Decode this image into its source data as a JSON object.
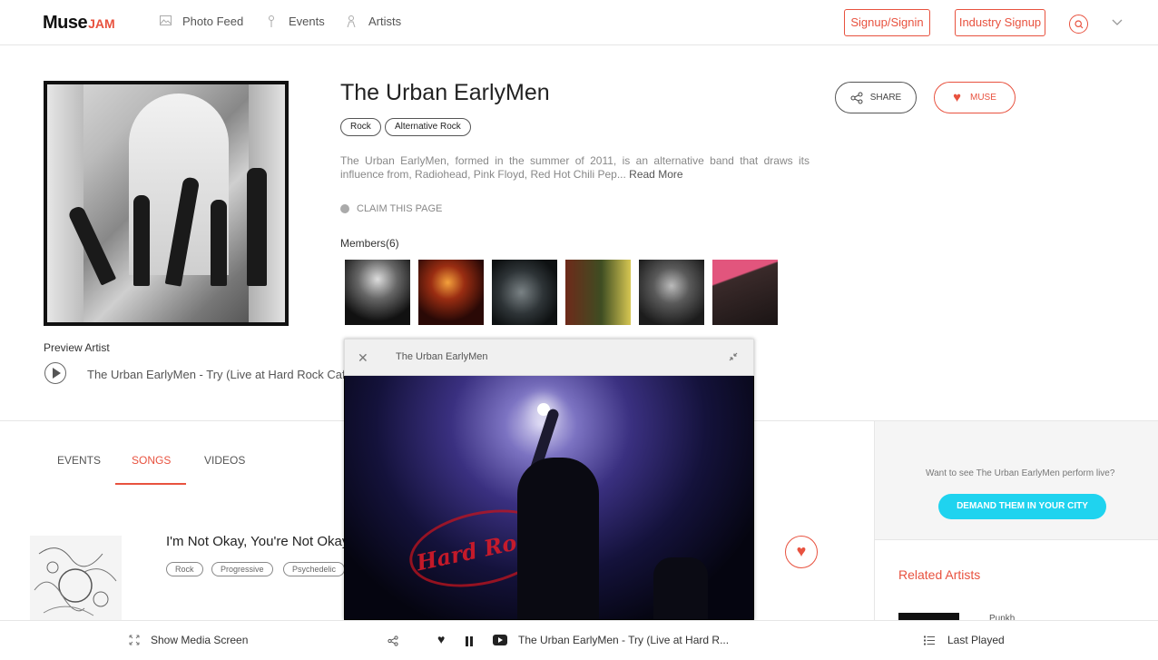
{
  "nav": {
    "logo_main": "Muse",
    "logo_accent": "JAM",
    "links": [
      {
        "label": "Photo Feed",
        "icon": "image-icon"
      },
      {
        "label": "Events",
        "icon": "mic-icon"
      },
      {
        "label": "Artists",
        "icon": "person-icon"
      }
    ],
    "signup_signin": "Signup/Signin",
    "industry_signup": "Industry Signup"
  },
  "artist": {
    "name": "The Urban EarlyMen",
    "tags": [
      "Rock",
      "Alternative Rock"
    ],
    "description": "The Urban EarlyMen, formed in the summer of 2011, is an alternative band that draws its influence from, Radiohead, Pink Floyd, Red Hot Chili Pep...",
    "read_more": "Read More",
    "claim": "CLAIM THIS PAGE",
    "members_label": "Members(6)",
    "share_label": "SHARE",
    "muse_label": "MUSE",
    "preview_label": "Preview Artist",
    "preview_track": "The Urban EarlyMen - Try (Live at Hard Rock Cafe Pune)"
  },
  "tabs": [
    {
      "label": "EVENTS",
      "active": false
    },
    {
      "label": "SONGS",
      "active": true
    },
    {
      "label": "VIDEOS",
      "active": false
    }
  ],
  "song": {
    "title": "I'm Not Okay, You're Not Okay",
    "tags": [
      "Rock",
      "Progressive",
      "Psychedelic"
    ]
  },
  "right": {
    "want_text": "Want to see The Urban EarlyMen perform live?",
    "demand_label": "DEMAND THEM IN YOUR CITY",
    "related_title": "Related Artists",
    "related_first": "Punkh"
  },
  "popup": {
    "title": "The Urban EarlyMen",
    "sign_text": "Hard Ro"
  },
  "player": {
    "show_media": "Show Media Screen",
    "now_playing": "The Urban EarlyMen - Try (Live at Hard R...",
    "last_played": "Last Played"
  },
  "colors": {
    "accent": "#e8523f",
    "demand": "#1fd3ef"
  }
}
